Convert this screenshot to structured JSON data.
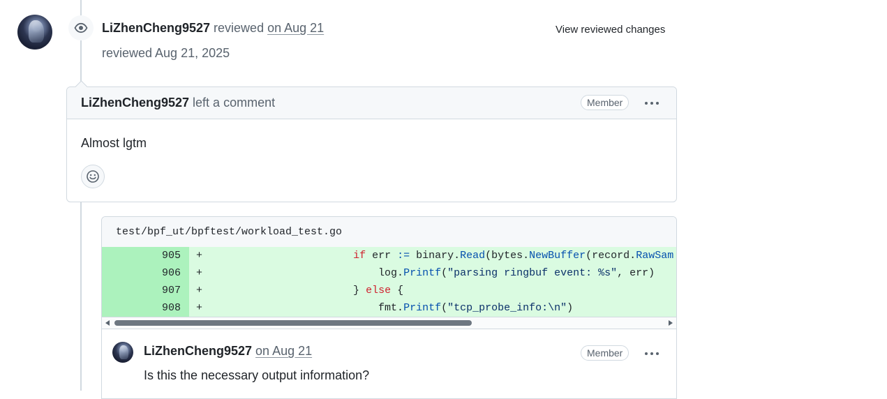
{
  "review": {
    "author": "LiZhenCheng9527",
    "action": "reviewed",
    "date_link": "on Aug 21",
    "view_changes_label": "View reviewed changes",
    "sub_text": "reviewed Aug 21, 2025"
  },
  "comment": {
    "author": "LiZhenCheng9527",
    "action": "left a comment",
    "badge": "Member",
    "body": "Almost lgtm"
  },
  "file": {
    "path": "test/bpf_ut/bpftest/workload_test.go",
    "lines": [
      {
        "num": "905",
        "sign": "+",
        "code": "                        if err := binary.Read(bytes.NewBuffer(record.RawSam"
      },
      {
        "num": "906",
        "sign": "+",
        "code": "                            log.Printf(\"parsing ringbuf event: %s\", err)"
      },
      {
        "num": "907",
        "sign": "+",
        "code": "                        } else {"
      },
      {
        "num": "908",
        "sign": "+",
        "code": "                            fmt.Printf(\"tcp_probe_info:\\n\")"
      }
    ]
  },
  "thread_comment": {
    "author": "LiZhenCheng9527",
    "date_link": "on Aug 21",
    "badge": "Member",
    "text": "Is this the necessary output information?"
  },
  "icons": [
    "eye-icon",
    "kebab-icon",
    "smiley-icon"
  ],
  "colors": {
    "added_line_bg": "#dafbe1",
    "added_num_bg": "#acf2bd",
    "keyword": "#cf222e",
    "function": "#0550ae",
    "string": "#0a3069"
  }
}
